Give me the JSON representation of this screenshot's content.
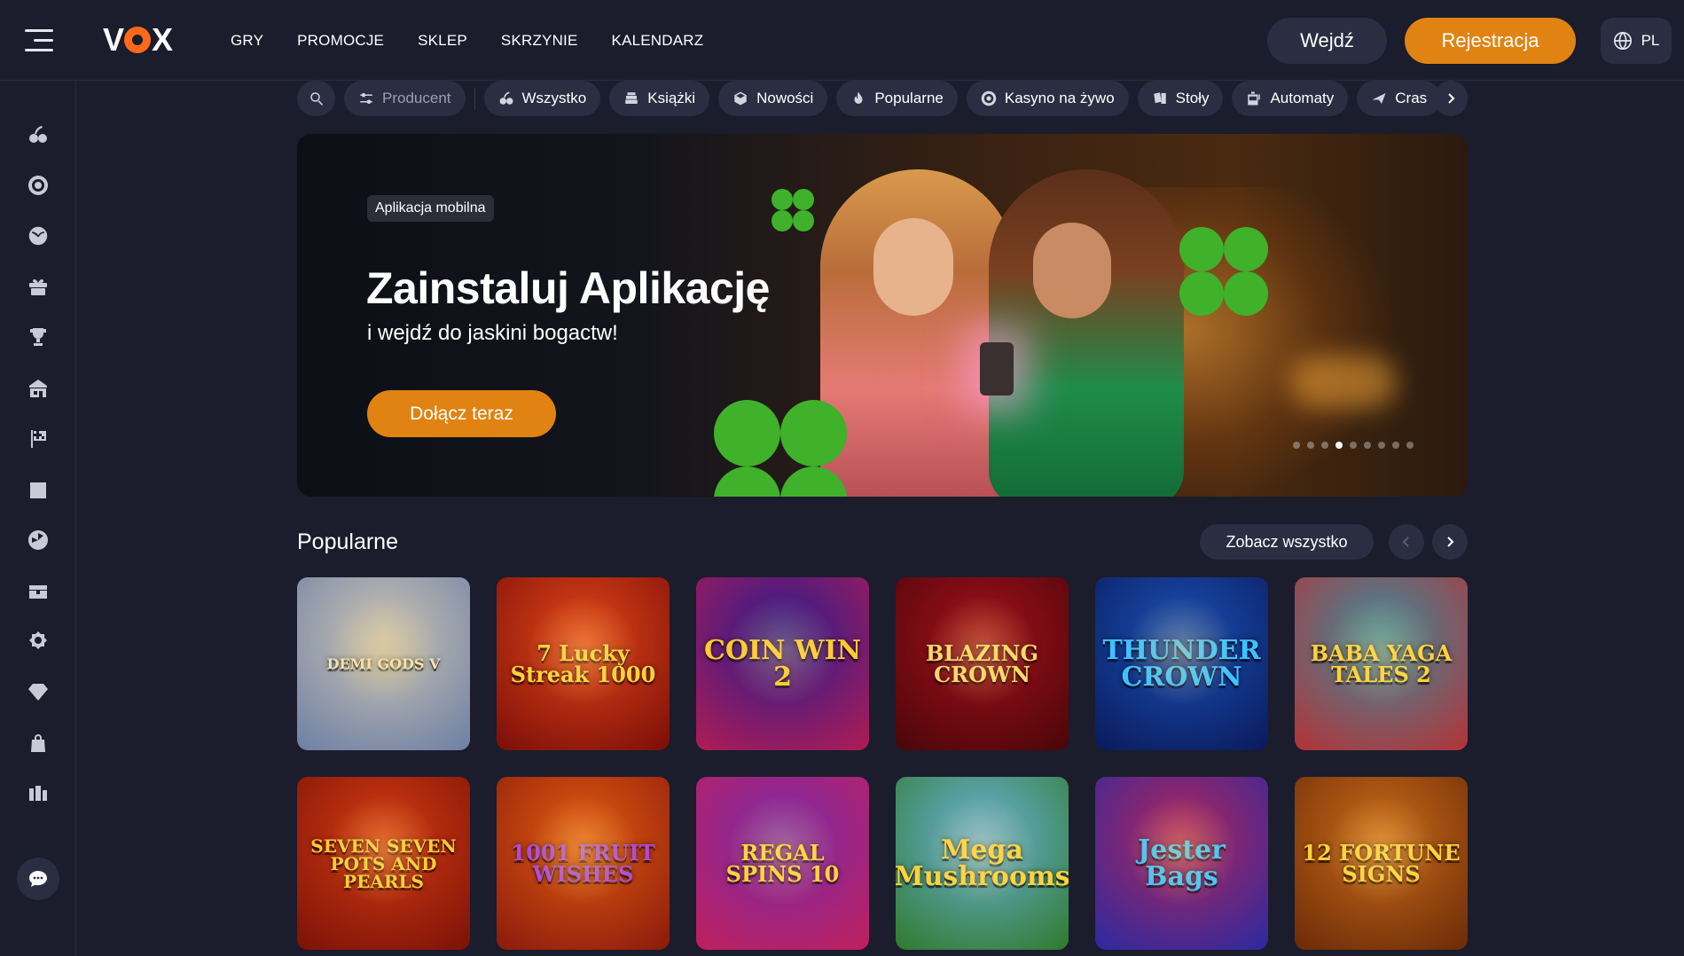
{
  "header": {
    "logo": "VOX",
    "nav": [
      "GRY",
      "PROMOCJE",
      "SKLEP",
      "SKRZYNIE",
      "KALENDARZ"
    ],
    "login_label": "Wejdź",
    "register_label": "Rejestracja",
    "language": "PL"
  },
  "sidebar": {
    "icons": [
      "cherries-icon",
      "roulette-icon",
      "sports-ball-icon",
      "gift-icon",
      "trophy-icon",
      "shop-icon",
      "checkered-flag-icon",
      "calendar-check-icon",
      "wheel-icon",
      "treasure-chest-icon",
      "badge-icon",
      "diamond-icon",
      "lock-bag-icon",
      "stats-icon"
    ],
    "chat_icon": "chat-icon"
  },
  "filters": {
    "producer_label": "Producent",
    "categories": [
      {
        "label": "Wszystko",
        "icon": "cherries-icon"
      },
      {
        "label": "Książki",
        "icon": "books-icon"
      },
      {
        "label": "Nowości",
        "icon": "cube-icon"
      },
      {
        "label": "Popularne",
        "icon": "flame-icon"
      },
      {
        "label": "Kasyno na żywo",
        "icon": "chip-icon"
      },
      {
        "label": "Stoły",
        "icon": "cards-icon"
      },
      {
        "label": "Automaty",
        "icon": "slot-machine-icon"
      },
      {
        "label": "Cras",
        "icon": "plane-icon"
      }
    ]
  },
  "banner": {
    "badge": "Aplikacja mobilna",
    "title": "Zainstaluj Aplikację",
    "subtitle": "i wejdź do jaskini bogactw!",
    "cta": "Dołącz teraz",
    "slides_total": 9,
    "active_slide": 4
  },
  "popular": {
    "title": "Popularne",
    "see_all": "Zobacz wszystko",
    "games": [
      {
        "name": "DEMI GODS V",
        "colors": [
          "#c9c2b4",
          "#6d7fa4"
        ],
        "text_color": "#f3e3b0",
        "size": 16
      },
      {
        "name": "7 Lucky Streak 1000",
        "colors": [
          "#e04418",
          "#7a0e08"
        ],
        "text_color": "#ffd23a",
        "size": 24
      },
      {
        "name": "COIN WIN 2",
        "colors": [
          "#2b1b8e",
          "#b01c54"
        ],
        "text_color": "#ffcb2f",
        "size": 30
      },
      {
        "name": "BLAZING CROWN",
        "colors": [
          "#a0101c",
          "#4a0609"
        ],
        "text_color": "#ffd56a",
        "size": 24
      },
      {
        "name": "THUNDER CROWN",
        "colors": [
          "#1a4fb4",
          "#0a1a5a"
        ],
        "text_color": "#3ec2ff",
        "size": 30
      },
      {
        "name": "BABA YAGA TALES 2",
        "colors": [
          "#3d8a9c",
          "#b43236"
        ],
        "text_color": "#ffd23a",
        "size": 24
      },
      {
        "name": "SEVEN SEVEN POTS AND PEARLS",
        "colors": [
          "#d33a10",
          "#7a1208"
        ],
        "text_color": "#ffcc33",
        "size": 20
      },
      {
        "name": "1001 FRUIT WISHES",
        "colors": [
          "#e05a10",
          "#8a1a0c"
        ],
        "text_color": "#b04ad8",
        "size": 24
      },
      {
        "name": "REGAL SPINS 10",
        "colors": [
          "#7a2aa8",
          "#c0205c"
        ],
        "text_color": "#ffd23a",
        "size": 24
      },
      {
        "name": "Mega Mushrooms",
        "colors": [
          "#6ab0d8",
          "#2f7a2c"
        ],
        "text_color": "#ffd23a",
        "size": 30
      },
      {
        "name": "Jester Bags",
        "colors": [
          "#b0245a",
          "#2a2aa0"
        ],
        "text_color": "#3ec2ff",
        "size": 30
      },
      {
        "name": "12 FORTUNE SIGNS",
        "colors": [
          "#c86a18",
          "#6a2a08"
        ],
        "text_color": "#ffd23a",
        "size": 24
      }
    ]
  },
  "colors": {
    "background": "#1b1c2c",
    "surface": "#2b2e42",
    "accent": "#e08313"
  }
}
